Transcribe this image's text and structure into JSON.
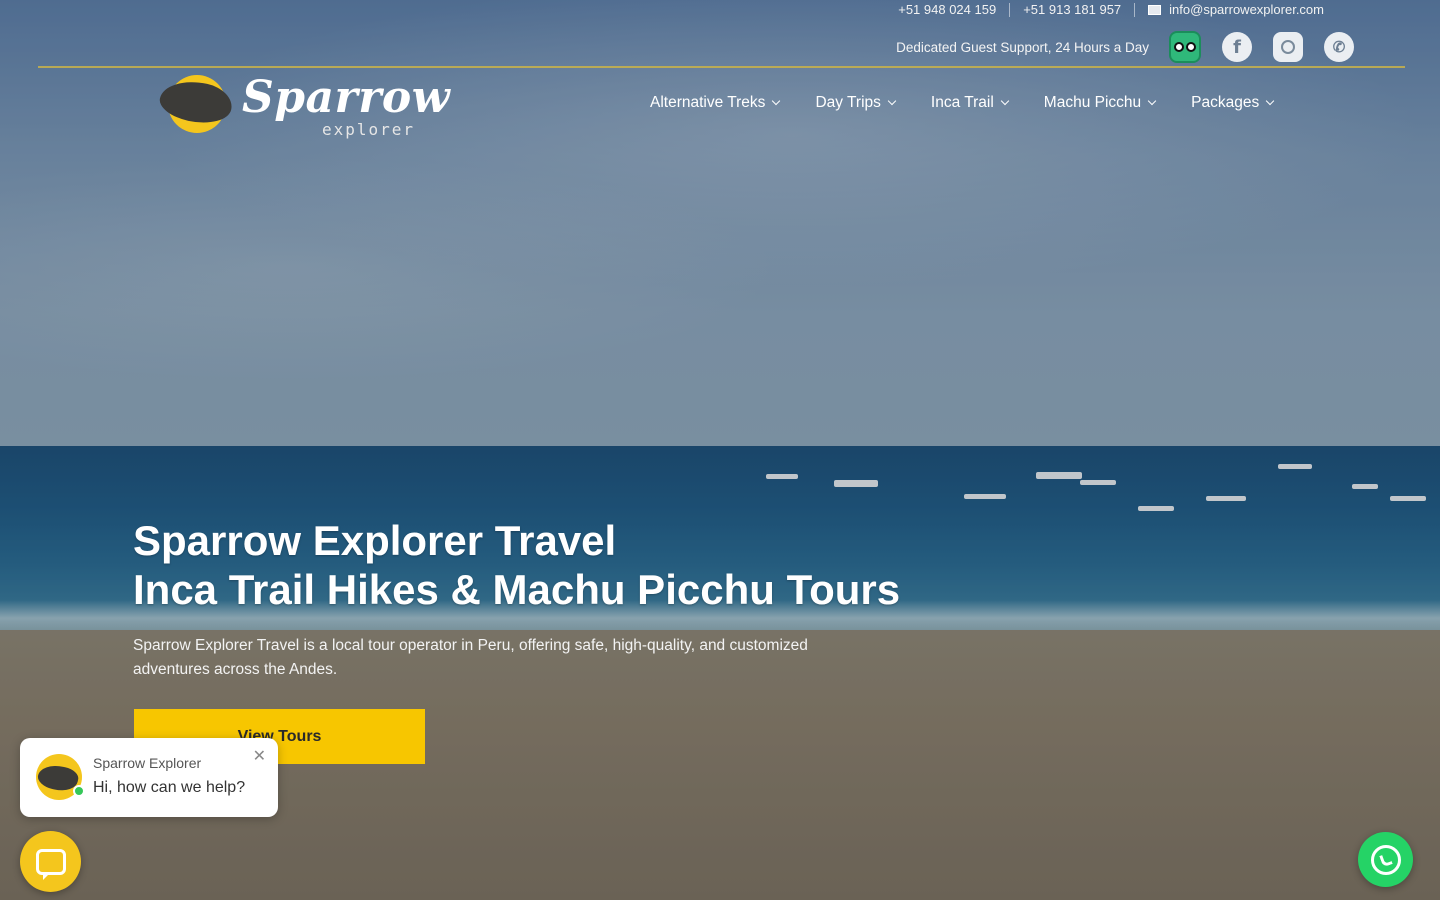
{
  "topbar": {
    "phone_1": "+51 948 024 159",
    "phone_2": "+51 913 181 957",
    "email": "info@sparrowexplorer.com",
    "support_text": "Dedicated Guest Support, 24 Hours a Day",
    "social_icons": [
      "tripadvisor-icon",
      "facebook-icon",
      "instagram-icon",
      "whatsapp-icon"
    ]
  },
  "logo": {
    "name": "Sparrow",
    "sub": "explorer"
  },
  "nav": {
    "items": [
      {
        "label": "Alternative Treks"
      },
      {
        "label": "Day Trips"
      },
      {
        "label": "Inca Trail"
      },
      {
        "label": "Machu Picchu"
      },
      {
        "label": "Packages"
      }
    ]
  },
  "hero": {
    "title_line_1": "Sparrow Explorer Travel",
    "title_line_2": "Inca Trail Hikes & Machu Picchu Tours",
    "description": "Sparrow Explorer Travel is a local tour operator in Peru, offering safe, high-quality, and customized adventures across the Andes.",
    "cta_label": "View Tours"
  },
  "chat": {
    "name": "Sparrow Explorer",
    "message": "Hi, how can we help?",
    "close_symbol": "✕"
  },
  "colors": {
    "accent": "#f7c600",
    "whatsapp": "#25d366",
    "divider": "#c9b34a"
  }
}
